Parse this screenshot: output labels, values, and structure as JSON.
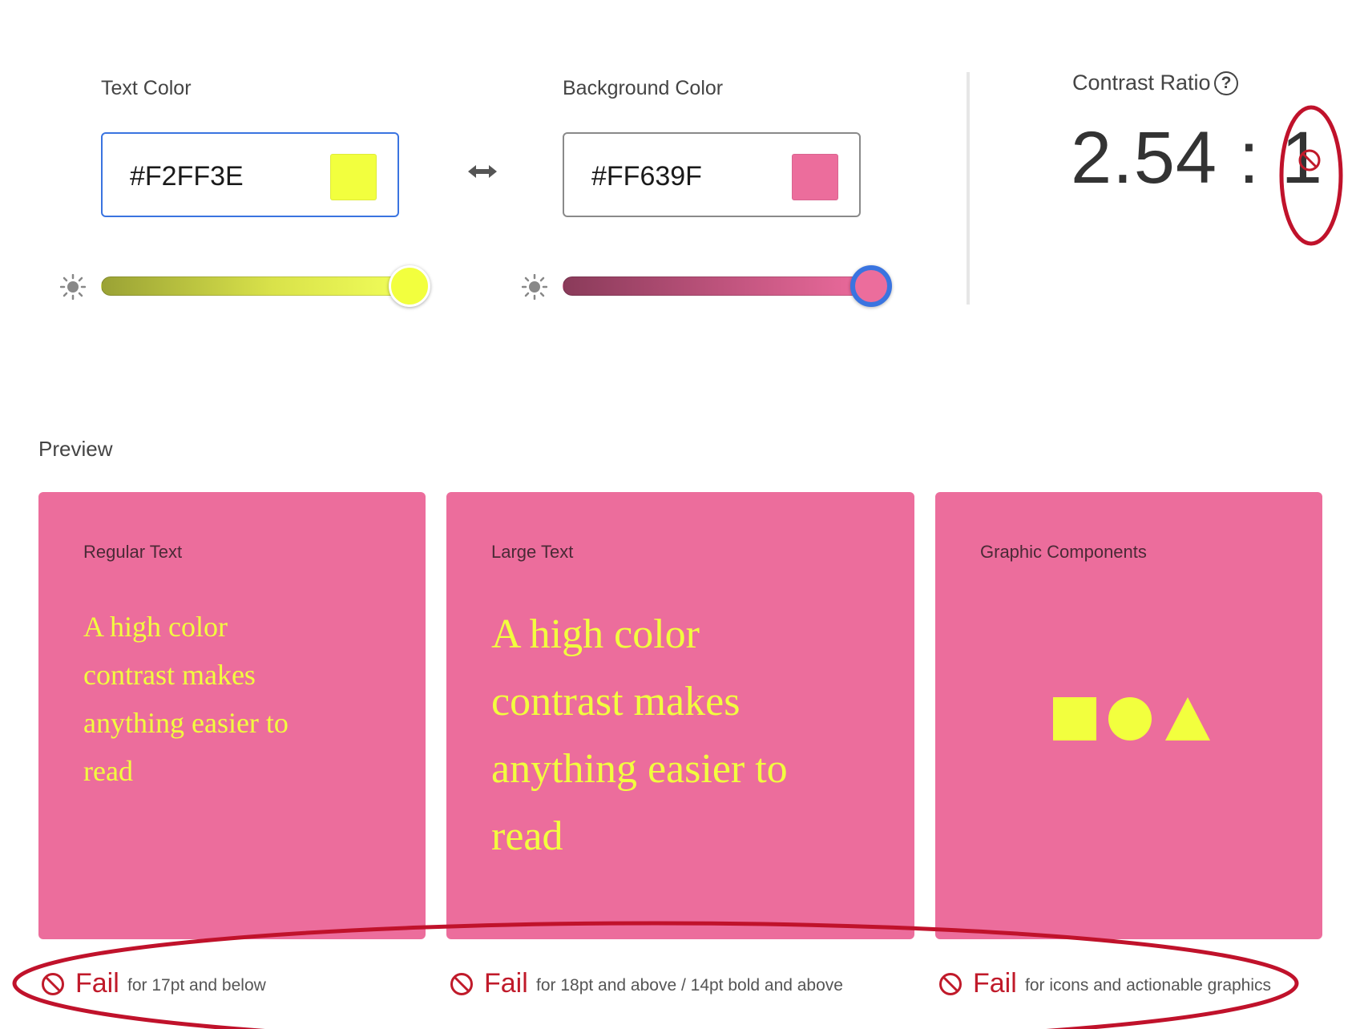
{
  "text_color": {
    "label": "Text Color",
    "value": "#F2FF3E",
    "swatch": "#F2FF3E",
    "slider_level": 1.0
  },
  "background_color": {
    "label": "Background Color",
    "value": "#FF639F",
    "swatch": "#EC6D9C",
    "slider_level": 1.0
  },
  "contrast": {
    "title": "Contrast Ratio",
    "help_icon": "question-circle-icon",
    "value": "2.54 : 1",
    "status_icon": "prohibited-icon"
  },
  "preview": {
    "title": "Preview",
    "cards": [
      {
        "title": "Regular Text",
        "lines": [
          "A high color",
          "contrast makes",
          "anything easier to",
          "read"
        ]
      },
      {
        "title": "Large Text",
        "lines": [
          "A high color",
          "contrast makes",
          "anything easier to",
          "read"
        ]
      },
      {
        "title": "Graphic Components",
        "shapes": [
          "square",
          "circle",
          "triangle"
        ]
      }
    ]
  },
  "results": [
    {
      "status": "Fail",
      "desc": "for 17pt and below",
      "icon": "prohibited-icon"
    },
    {
      "status": "Fail",
      "desc": "for 18pt and above / 14pt bold and above",
      "icon": "prohibited-icon"
    },
    {
      "status": "Fail",
      "desc": "for icons and actionable graphics",
      "icon": "prohibited-icon"
    }
  ],
  "colors": {
    "fail_red": "#C01A2A",
    "focus_blue": "#3A74E0",
    "card_bg": "#EC6D9C",
    "preview_fg": "#F2FF3E"
  }
}
